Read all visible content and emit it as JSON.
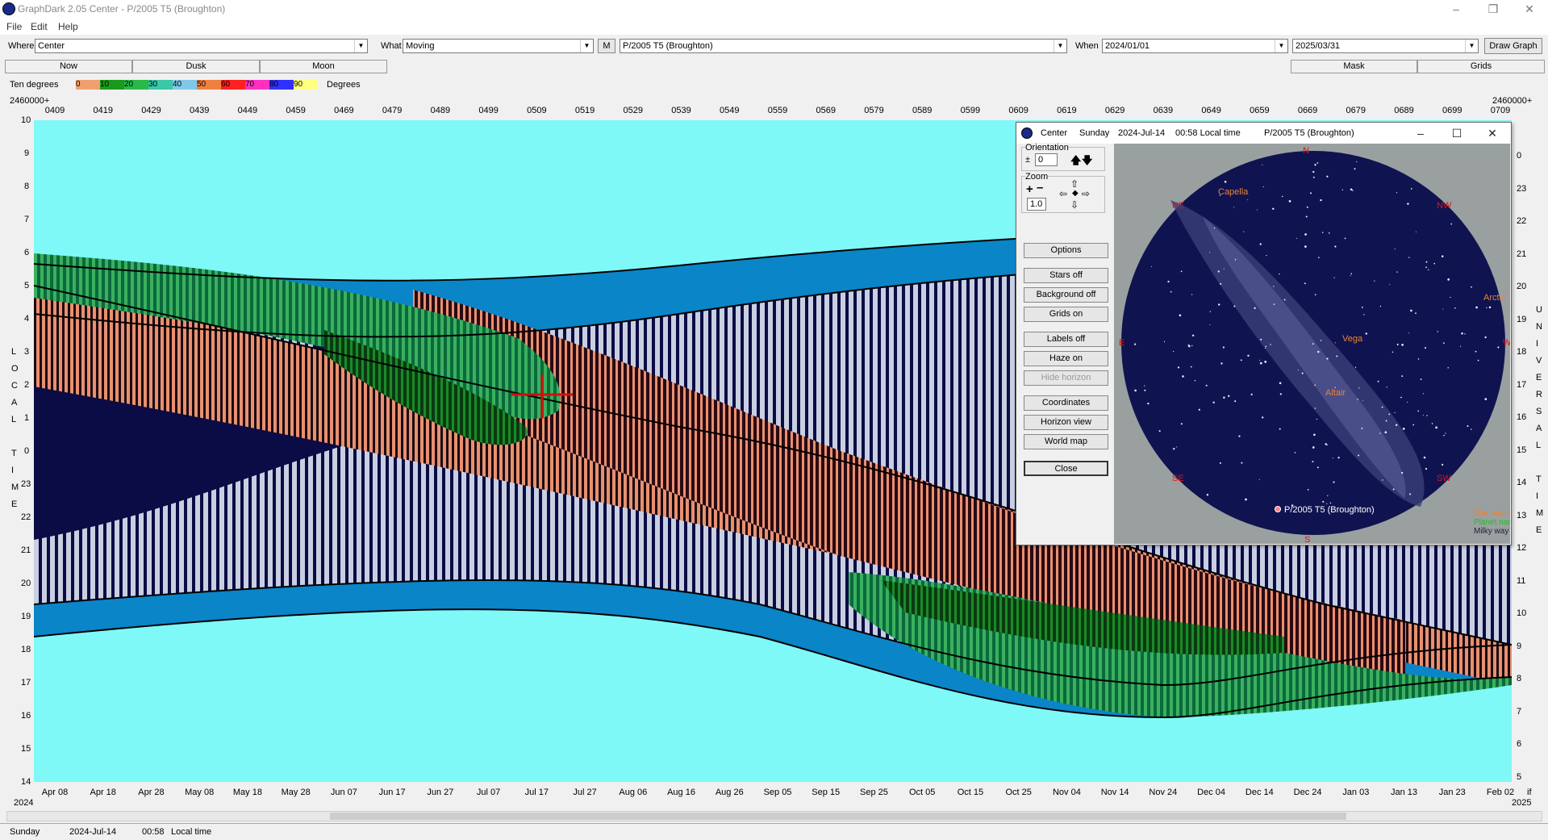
{
  "window": {
    "title": "GraphDark 2.05  Center  -  P/2005 T5 (Broughton)"
  },
  "menu": [
    "File",
    "Edit",
    "Help"
  ],
  "toolbar": {
    "where_label": "Where",
    "where_value": "Center",
    "what_label": "What",
    "what_value": "Moving",
    "m_label": "M",
    "object_value": "P/2005 T5 (Broughton)",
    "when_label": "When",
    "from_date": "2024/01/01",
    "to_date": "2025/03/31",
    "draw_label": "Draw Graph"
  },
  "tabs": {
    "now": "Now",
    "dusk": "Dusk",
    "moon": "Moon",
    "mask": "Mask",
    "grids": "Grids"
  },
  "legend": {
    "label": "Ten degrees",
    "unit": "Degrees",
    "steps": [
      {
        "v": "0",
        "c": "#f0a070"
      },
      {
        "v": "10",
        "c": "#1a9a1a"
      },
      {
        "v": "20",
        "c": "#2ab84a"
      },
      {
        "v": "30",
        "c": "#3ac8a8"
      },
      {
        "v": "40",
        "c": "#80c8e8"
      },
      {
        "v": "50",
        "c": "#f08040"
      },
      {
        "v": "60",
        "c": "#ff2020"
      },
      {
        "v": "70",
        "c": "#ff30c0"
      },
      {
        "v": "80",
        "c": "#3030ff"
      },
      {
        "v": "90",
        "c": "#ffff80"
      }
    ]
  },
  "axis": {
    "top_left": "2460000+",
    "top_right": "2460000+",
    "jd_ticks": [
      "0409",
      "0419",
      "0429",
      "0439",
      "0449",
      "0459",
      "0469",
      "0479",
      "0489",
      "0499",
      "0509",
      "0519",
      "0529",
      "0539",
      "0549",
      "0559",
      "0569",
      "0579",
      "0589",
      "0599",
      "0609",
      "0619",
      "0629",
      "0639",
      "0649",
      "0659",
      "0669",
      "0679",
      "0689",
      "0699",
      "0709"
    ],
    "date_ticks": [
      "Apr 08",
      "Apr 18",
      "Apr 28",
      "May 08",
      "May 18",
      "May 28",
      "Jun 07",
      "Jun 17",
      "Jun 27",
      "Jul 07",
      "Jul 17",
      "Jul 27",
      "Aug 06",
      "Aug 16",
      "Aug 26",
      "Sep 05",
      "Sep 15",
      "Sep 25",
      "Oct 05",
      "Oct 15",
      "Oct 25",
      "Nov 04",
      "Nov 14",
      "Nov 24",
      "Dec 04",
      "Dec 14",
      "Dec 24",
      "Jan 03",
      "Jan 13",
      "Jan 23",
      "Feb 02"
    ],
    "year_left": "2024",
    "year_right": "2025",
    "bottom_right_tag": "if",
    "left_hours": [
      "10",
      "9",
      "8",
      "7",
      "6",
      "5",
      "4",
      "3",
      "2",
      "1",
      "0",
      "23",
      "22",
      "21",
      "20",
      "19",
      "18",
      "17",
      "16",
      "15",
      "14"
    ],
    "right_hours": [
      "0",
      "23",
      "22",
      "21",
      "20",
      "19",
      "18",
      "17",
      "16",
      "15",
      "14",
      "13",
      "12",
      "11",
      "10",
      "9",
      "8",
      "7",
      "6",
      "5"
    ],
    "left_title": [
      "L",
      "O",
      "C",
      "A",
      "L",
      "",
      "T",
      "I",
      "M",
      "E"
    ],
    "right_title": [
      "U",
      "N",
      "I",
      "V",
      "E",
      "R",
      "S",
      "A",
      "L",
      "",
      "T",
      "I",
      "M",
      "E"
    ]
  },
  "status": {
    "day": "Sunday",
    "date": "2024-Jul-14",
    "time": "00:58",
    "tz": "Local time"
  },
  "sky": {
    "title_place": "Center",
    "title_day": "Sunday",
    "title_date": "2024-Jul-14",
    "title_time": "00:58 Local time",
    "title_object": "P/2005 T5 (Broughton)",
    "orientation_label": "Orientation",
    "orientation_value": "0",
    "zoom_label": "Zoom",
    "zoom_value": "1.0",
    "buttons": [
      "Options",
      "Stars off",
      "Background off",
      "Grids on",
      "Labels off",
      "Haze on",
      "Hide horizon",
      "Coordinates",
      "Horizon view",
      "World map",
      "Close"
    ],
    "directions": {
      "n": "N",
      "ne": "NE",
      "nw": "NW",
      "e": "E",
      "w": "W",
      "se": "SE",
      "sw": "SW",
      "s": "S"
    },
    "stars": [
      "Capella",
      "Vega",
      "Altair",
      "Arctur"
    ],
    "object_label": "P/2005 T5 (Broughton)",
    "legend": [
      "Star name",
      "Planet name",
      "Milky way"
    ]
  }
}
